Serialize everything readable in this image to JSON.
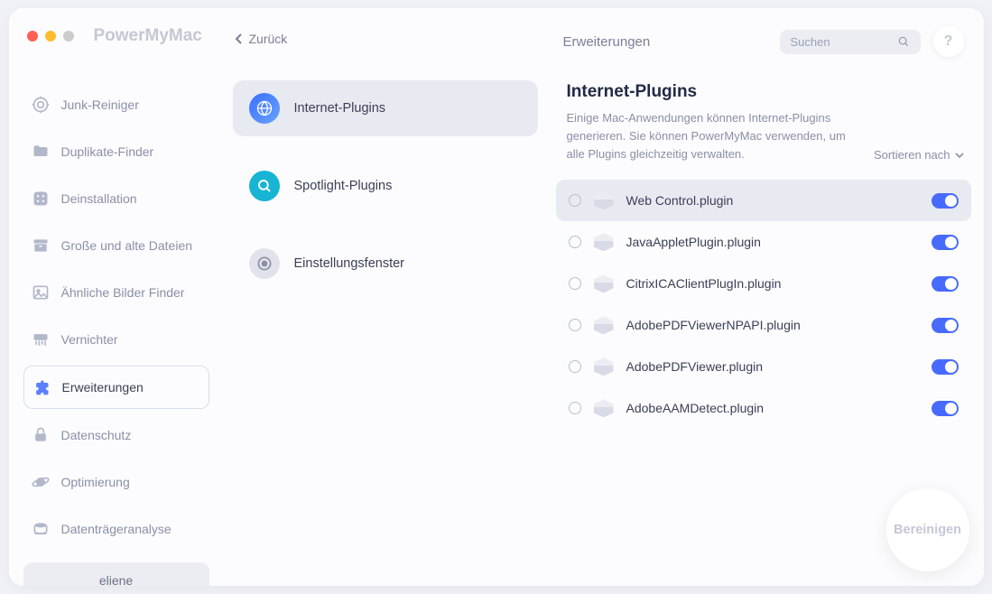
{
  "app": {
    "title": "PowerMyMac"
  },
  "sidebar": {
    "items": [
      {
        "label": "Junk-Reiniger"
      },
      {
        "label": "Duplikate-Finder"
      },
      {
        "label": "Deinstallation"
      },
      {
        "label": "Große und alte Dateien"
      },
      {
        "label": "Ähnliche Bilder Finder"
      },
      {
        "label": "Vernichter"
      },
      {
        "label": "Erweiterungen"
      },
      {
        "label": "Datenschutz"
      },
      {
        "label": "Optimierung"
      },
      {
        "label": "Datenträgeranalyse"
      }
    ],
    "user": "eliene"
  },
  "middle": {
    "back_label": "Zurück",
    "categories": [
      {
        "label": "Internet-Plugins"
      },
      {
        "label": "Spotlight-Plugins"
      },
      {
        "label": "Einstellungsfenster"
      }
    ]
  },
  "main": {
    "top_title": "Erweiterungen",
    "search_placeholder": "Suchen",
    "help_label": "?",
    "heading": "Internet-Plugins",
    "description": "Einige Mac-Anwendungen können Internet-Plugins generieren. Sie können PowerMyMac verwenden, um alle Plugins gleichzeitig verwalten.",
    "sort_label": "Sortieren nach",
    "plugins": [
      {
        "name": "Web Control.plugin",
        "enabled": true
      },
      {
        "name": "JavaAppletPlugin.plugin",
        "enabled": true
      },
      {
        "name": "CitrixICAClientPlugIn.plugin",
        "enabled": true
      },
      {
        "name": "AdobePDFViewerNPAPI.plugin",
        "enabled": true
      },
      {
        "name": "AdobePDFViewer.plugin",
        "enabled": true
      },
      {
        "name": "AdobeAAMDetect.plugin",
        "enabled": true
      }
    ],
    "clean_label": "Bereinigen"
  }
}
